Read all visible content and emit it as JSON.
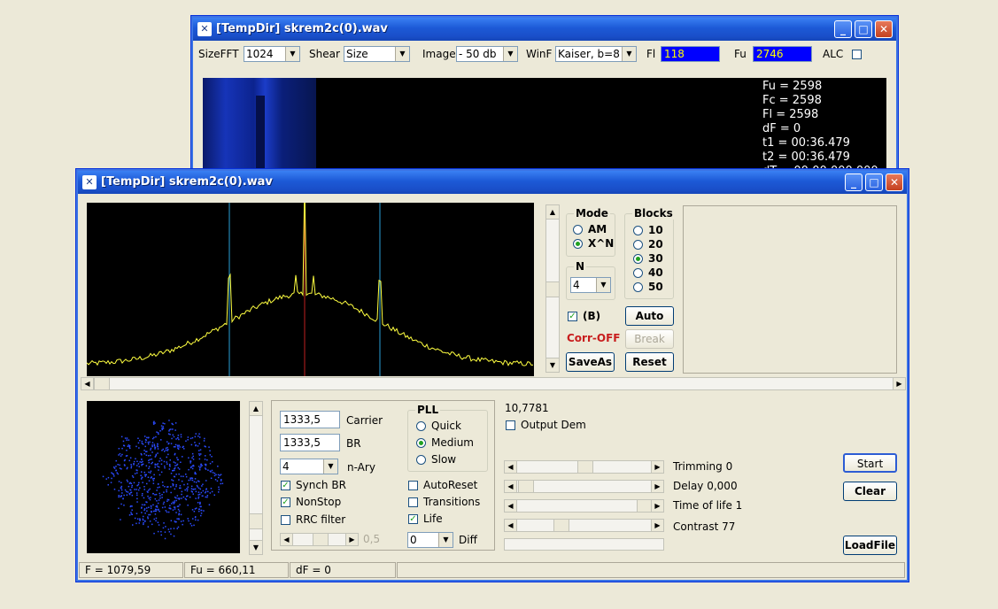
{
  "back_window": {
    "title": "[TempDir] skrem2c(0).wav",
    "toolbar": {
      "sizefft_label": "SizeFFT",
      "sizefft_value": "1024",
      "shear_label": "Shear",
      "shear_value": "Size",
      "image_label": "Image",
      "image_value": "- 50 db",
      "winf_label": "WinF",
      "winf_value": "Kaiser, b=8",
      "fl_label": "Fl",
      "fl_value": "118",
      "fu_label": "Fu",
      "fu_value": "2746",
      "alc_label": "ALC"
    },
    "info_lines": [
      "Fu = 2598",
      "Fc = 2598",
      "Fl = 2598",
      "dF = 0",
      "t1 = 00:36.479",
      "t2 = 00:36.479",
      "dT = 00:00.000.000"
    ]
  },
  "front_window": {
    "title": "[TempDir] skrem2c(0).wav",
    "mode": {
      "title": "Mode",
      "options": [
        "AM",
        "X^N"
      ],
      "selected": "X^N"
    },
    "blocks": {
      "title": "Blocks",
      "options": [
        "10",
        "20",
        "30",
        "40",
        "50"
      ],
      "selected": "30"
    },
    "n_group": {
      "title": "N",
      "value": "4"
    },
    "b_check_label": "(B)",
    "corr_status": "Corr-OFF",
    "buttons": {
      "auto": "Auto",
      "break": "Break",
      "saveas": "SaveAs",
      "reset": "Reset",
      "start": "Start",
      "clear": "Clear",
      "loadfile": "LoadFile"
    },
    "carrier_value": "1333,5",
    "carrier_label": "Carrier",
    "br_value": "1333,5",
    "br_label": "BR",
    "nary_value": "4",
    "nary_label": "n-Ary",
    "synch_br": "Synch BR",
    "nonstop": "NonStop",
    "rrc_filter": "RRC filter",
    "rrc_value": "0,5",
    "pll": {
      "title": "PLL",
      "options": [
        "Quick",
        "Medium",
        "Slow"
      ],
      "selected": "Medium"
    },
    "autoreset": "AutoReset",
    "transitions": "Transitions",
    "life": "Life",
    "diff_value": "0",
    "diff_label": "Diff",
    "readout": "10,7781",
    "output_dem": "Output Dem",
    "sliders": [
      {
        "label": "Trimming 0",
        "level": 0.5
      },
      {
        "label": "Delay  0,000",
        "level": 0.02
      },
      {
        "label": "Time of life 1",
        "level": 0.98
      },
      {
        "label": "Contrast 77",
        "level": 0.3
      }
    ],
    "statusbar": [
      "F = 1079,59",
      "Fu = 660,11",
      "dF = 0",
      ""
    ],
    "colors": {
      "spectrum": "#ffff40",
      "cursor_left": "#2aa0d8",
      "cursor_center": "#c02020",
      "constellation": "#2b4bff"
    }
  }
}
